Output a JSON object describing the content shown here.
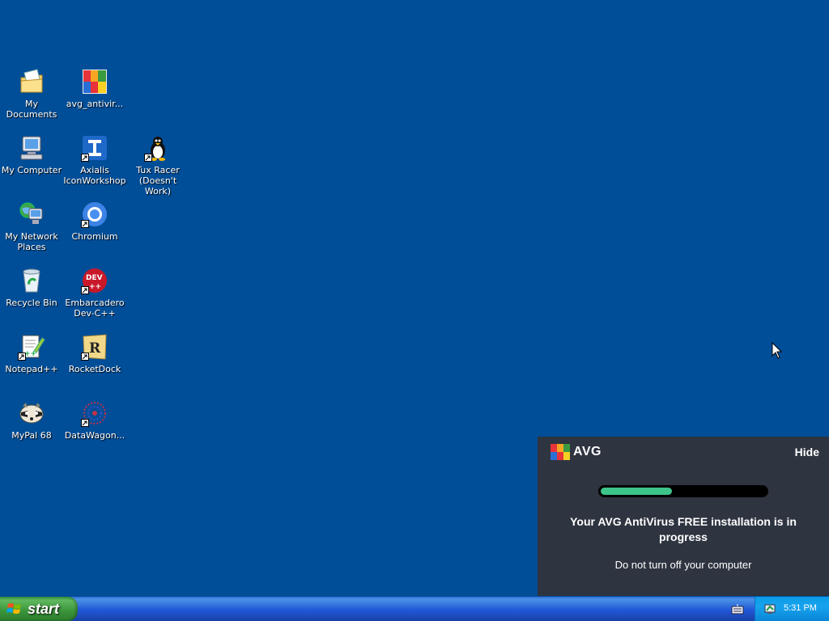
{
  "desktop": {
    "icons": [
      {
        "label": "My Documents",
        "icon": "my-documents-icon"
      },
      {
        "label": "avg_antivir...",
        "icon": "avg-installer-icon"
      },
      {
        "label": "My Computer",
        "icon": "my-computer-icon"
      },
      {
        "label": "Axialis\nIconWorkshop",
        "icon": "axialis-iconworkshop-icon"
      },
      {
        "label": "Tux Racer\n(Doesn't Work)",
        "icon": "tux-racer-icon"
      },
      {
        "label": "My Network\nPlaces",
        "icon": "my-network-places-icon"
      },
      {
        "label": "Chromium",
        "icon": "chromium-icon"
      },
      {
        "label": "Recycle Bin",
        "icon": "recycle-bin-icon"
      },
      {
        "label": "Embarcadero\nDev-C++",
        "icon": "dev-cpp-icon"
      },
      {
        "label": "Notepad++",
        "icon": "notepad-plus-plus-icon"
      },
      {
        "label": "RocketDock",
        "icon": "rocketdock-icon"
      },
      {
        "label": "MyPal 68",
        "icon": "mypal-icon"
      },
      {
        "label": "DataWagon...",
        "icon": "datawagon-icon"
      }
    ]
  },
  "avg_notification": {
    "brand": "AVG",
    "hide_label": "Hide",
    "progress_fraction": 0.43,
    "title": "Your AVG AntiVirus FREE installation is in progress",
    "subtitle": "Do not turn off your computer"
  },
  "taskbar": {
    "start_label": "start",
    "clock": "5:31 PM"
  },
  "colors": {
    "desktop_background": "#004e98",
    "toast_background": "#2e3440",
    "progress_fill": "#3dc48a"
  }
}
